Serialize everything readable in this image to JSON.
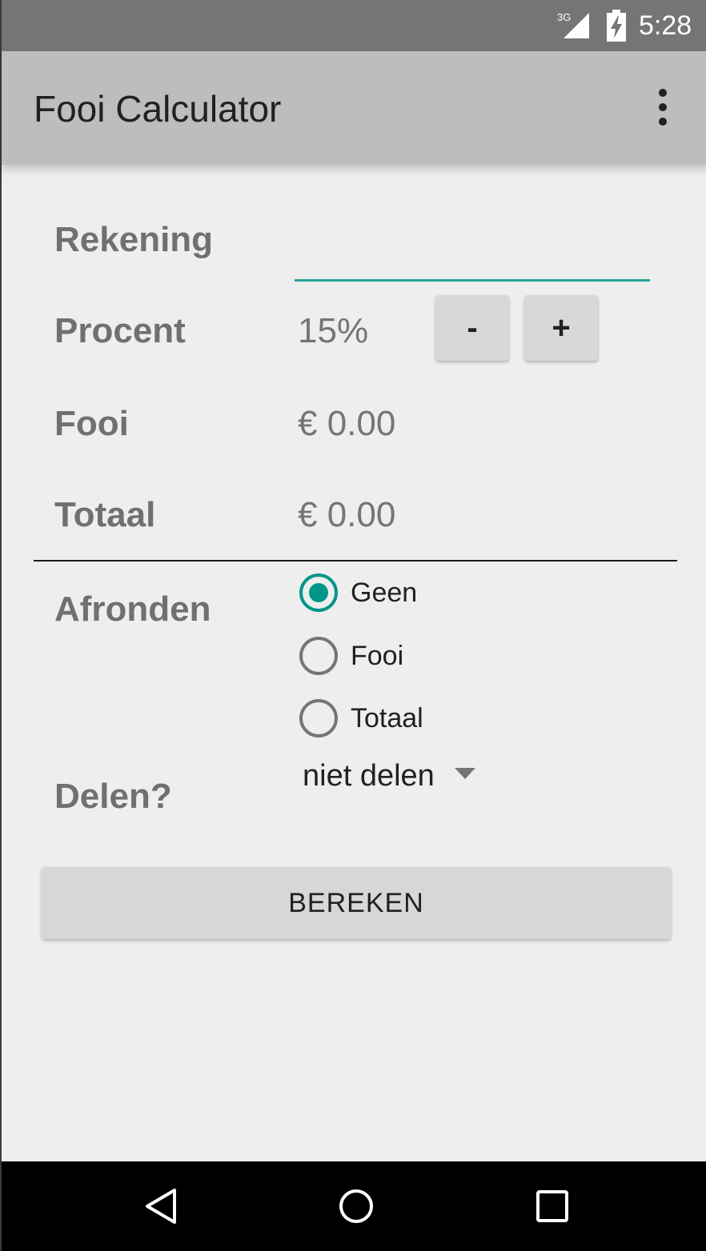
{
  "status_bar": {
    "network": "3G",
    "time": "5:28",
    "icons": [
      "signal-3g-icon",
      "battery-charging-icon"
    ]
  },
  "app_bar": {
    "title": "Fooi Calculator",
    "menu_icon": "more-vert-icon"
  },
  "form": {
    "rekening": {
      "label": "Rekening",
      "value": "",
      "placeholder": ""
    },
    "procent": {
      "label": "Procent",
      "value": "15%",
      "minus_label": "-",
      "plus_label": "+"
    },
    "fooi": {
      "label": "Fooi",
      "value": "€ 0.00"
    },
    "totaal": {
      "label": "Totaal",
      "value": "€ 0.00"
    },
    "afronden": {
      "label": "Afronden",
      "options": [
        {
          "label": "Geen",
          "checked": true
        },
        {
          "label": "Fooi",
          "checked": false
        },
        {
          "label": "Totaal",
          "checked": false
        }
      ]
    },
    "delen": {
      "label": "Delen?",
      "selected": "niet delen"
    },
    "calculate_label": "BEREKEN"
  },
  "nav_bar": {
    "icons": [
      "back-icon",
      "home-icon",
      "recents-icon"
    ]
  },
  "colors": {
    "accent": "#009688",
    "input_underline": "#26a69a",
    "app_bar": "#bdbdbd",
    "status_bar": "#757575"
  }
}
